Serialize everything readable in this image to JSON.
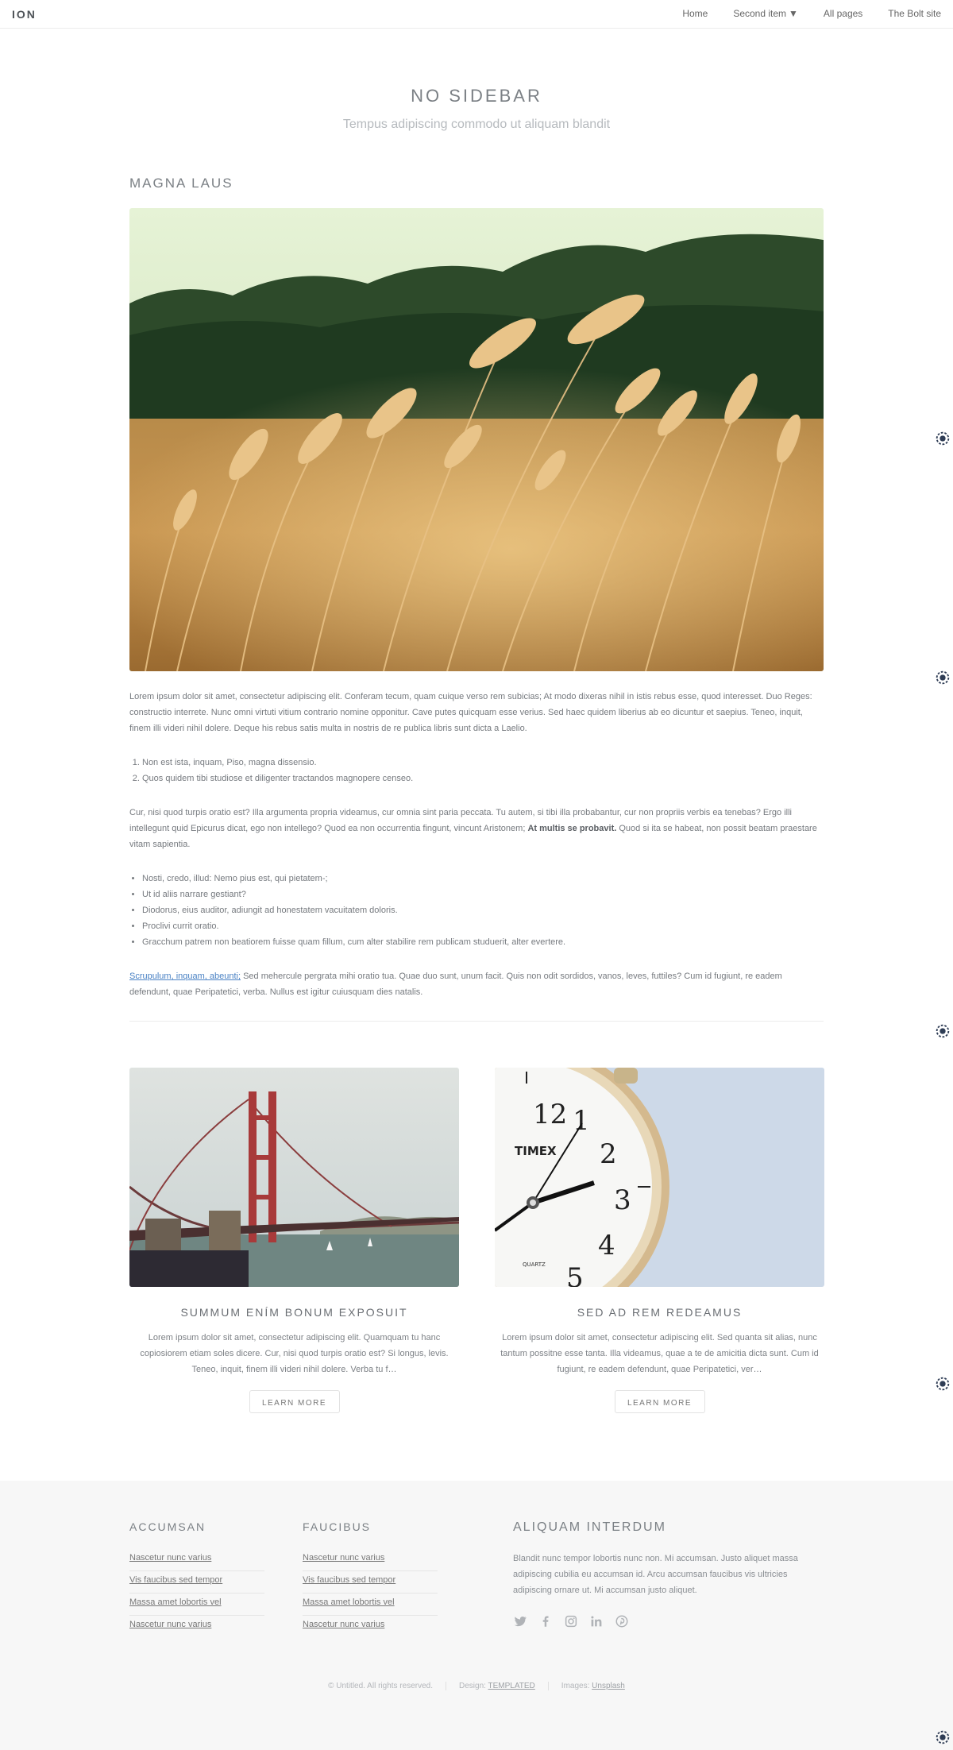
{
  "header": {
    "logo": "ION",
    "nav": [
      {
        "label": "Home"
      },
      {
        "label": "Second item",
        "caret": "▼"
      },
      {
        "label": "All pages"
      },
      {
        "label": "The Bolt site"
      }
    ]
  },
  "page": {
    "title": "NO SIDEBAR",
    "subtitle": "Tempus adipiscing commodo ut aliquam blandit"
  },
  "article": {
    "title": "MAGNA LAUS",
    "hero_image": "wheat-field-photo",
    "paragraph1": "Lorem ipsum dolor sit amet, consectetur adipiscing elit. Conferam tecum, quam cuique verso rem subicias; At modo dixeras nihil in istis rebus esse, quod interesset. Duo Reges: constructio interrete. Nunc omni virtuti vitium contrario nomine opponitur. Cave putes quicquam esse verius. Sed haec quidem liberius ab eo dicuntur et saepius. Teneo, inquit, finem illi videri nihil dolere. Deque his rebus satis multa in nostris de re publica libris sunt dicta a Laelio.",
    "ordered_list": [
      "Non est ista, inquam, Piso, magna dissensio.",
      "Quos quidem tibi studiose et diligenter tractandos magnopere censeo."
    ],
    "paragraph2_start": "Cur, nisi quod turpis oratio est? Illa argumenta propria videamus, cur omnia sint paria peccata. Tu autem, si tibi illa probabantur, cur non propriis verbis ea tenebas? Ergo illi intellegunt quid Epicurus dicat, ego non intellego? Quod ea non occurrentia fingunt, vincunt Aristonem; ",
    "paragraph2_bold": "At multis se probavit.",
    "paragraph2_end": " Quod si ita se habeat, non possit beatam praestare vitam sapientia.",
    "bullet_list": [
      "Nosti, credo, illud: Nemo pius est, qui pietatem-;",
      "Ut id aliis narrare gestiant?",
      "Diodorus, eius auditor, adiungit ad honestatem vacuitatem doloris.",
      "Proclivi currit oratio.",
      "Gracchum patrem non beatiorem fuisse quam fillum, cum alter stabilire rem publicam studuerit, alter evertere."
    ],
    "paragraph3_link": "Scrupulum, inquam, abeunti;",
    "paragraph3_rest": " Sed mehercule pergrata mihi oratio tua. Quae duo sunt, unum facit. Quis non odit sordidos, vanos, leves, futtiles? Cum id fugiunt, re eadem defendunt, quae Peripatetici, verba. Nullus est igitur cuiusquam dies natalis."
  },
  "cards": [
    {
      "image": "golden-gate-bridge-photo",
      "title": "SUMMUM ENÍM BONUM EXPOSUIT",
      "text": "Lorem ipsum dolor sit amet, consectetur adipiscing elit. Quamquam tu hanc copiosiorem etiam soles dicere. Cur, nisi quod turpis oratio est? Si longus, levis. Teneo, inquit, finem illi videri nihil dolere. Verba tu f…",
      "button": "LEARN MORE"
    },
    {
      "image": "alarm-clock-photo",
      "title": "SED AD REM REDEAMUS",
      "text": "Lorem ipsum dolor sit amet, consectetur adipiscing elit. Sed quanta sit alias, nunc tantum possitne esse tanta. Illa videamus, quae a te de amicitia dicta sunt. Cum id fugiunt, re eadem defendunt, quae Peripatetici, ver…",
      "button": "LEARN MORE",
      "clock_brand": "TIMEX",
      "clock_sub": "QUARTZ",
      "clock_numbers": [
        "12",
        "1",
        "2",
        "3",
        "4",
        "5"
      ]
    }
  ],
  "footer": {
    "col1": {
      "title": "ACCUMSAN",
      "links": [
        "Nascetur nunc varius",
        "Vis faucibus sed tempor",
        "Massa amet lobortis vel",
        "Nascetur nunc varius"
      ]
    },
    "col2": {
      "title": "FAUCIBUS",
      "links": [
        "Nascetur nunc varius",
        "Vis faucibus sed tempor",
        "Massa amet lobortis vel",
        "Nascetur nunc varius"
      ]
    },
    "col3": {
      "title": "ALIQUAM INTERDUM",
      "text": "Blandit nunc tempor lobortis nunc non. Mi accumsan. Justo aliquet massa adipiscing cubilia eu accumsan id. Arcu accumsan faucibus vis ultricies adipiscing ornare ut. Mi accumsan justo aliquet.",
      "socials": [
        "twitter-icon",
        "facebook-icon",
        "instagram-icon",
        "linkedin-icon",
        "pinterest-icon"
      ]
    },
    "copyright": "© Untitled. All rights reserved.",
    "design_label": "Design: ",
    "design_link": "TEMPLATED",
    "images_label": "Images: ",
    "images_link": "Unsplash"
  },
  "colors": {
    "link": "#4a82c4",
    "footer_bg": "#f7f7f7",
    "heading": "#7b8085",
    "widget": "#2f3d55"
  }
}
